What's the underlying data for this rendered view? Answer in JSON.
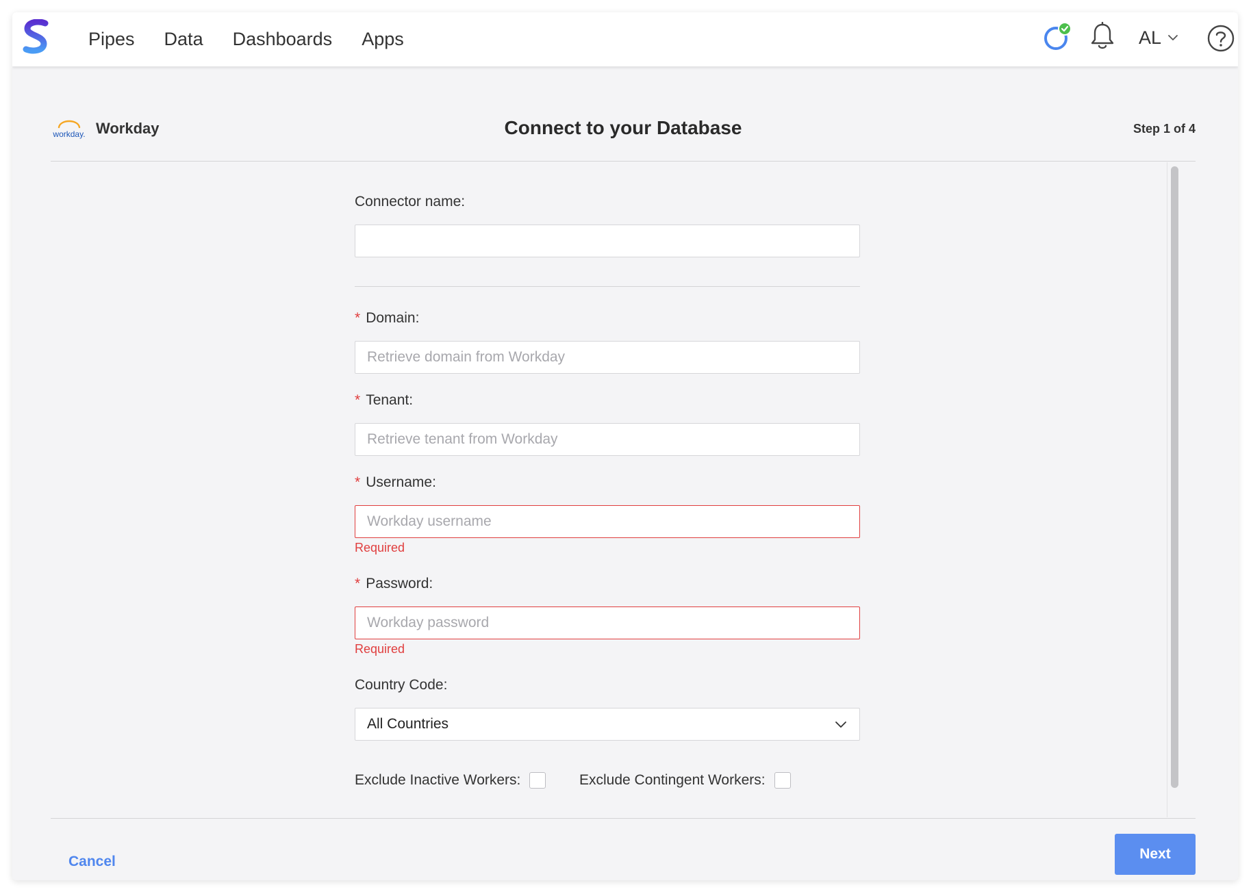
{
  "nav": {
    "items": [
      "Pipes",
      "Data",
      "Dashboards",
      "Apps"
    ]
  },
  "user": {
    "initials": "AL"
  },
  "header": {
    "connector": "Workday",
    "logo_text": "workday.",
    "title": "Connect to your Database",
    "step": "Step 1 of 4"
  },
  "form": {
    "connector_name": {
      "label": "Connector name",
      "value": ""
    },
    "domain": {
      "label": "Domain",
      "placeholder": "Retrieve domain from Workday",
      "required": "*"
    },
    "tenant": {
      "label": "Tenant",
      "placeholder": "Retrieve tenant from Workday",
      "required": "*"
    },
    "username": {
      "label": "Username",
      "placeholder": "Workday username",
      "required": "*",
      "error": "Required"
    },
    "password": {
      "label": "Password",
      "placeholder": "Workday password",
      "required": "*",
      "error": "Required"
    },
    "country_code": {
      "label": "Country Code",
      "value": "All Countries"
    },
    "exclude_inactive": {
      "label": "Exclude Inactive Workers"
    },
    "exclude_contingent": {
      "label": "Exclude Contingent Workers"
    },
    "colon": ":"
  },
  "footer": {
    "cancel": "Cancel",
    "next": "Next"
  },
  "colors": {
    "accent": "#5b8ef0",
    "error": "#e03e3e",
    "sync_ok": "#4cbf4c"
  }
}
